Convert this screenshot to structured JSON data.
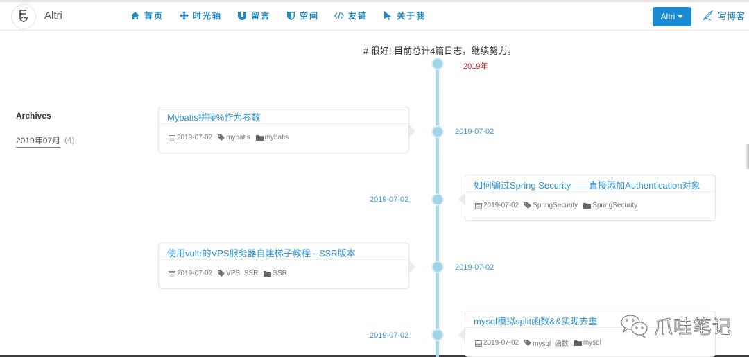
{
  "navbar": {
    "brand": "Altri",
    "logo_icon": "smiley-e-logo-icon",
    "items": [
      {
        "label": "首页",
        "icon": "home-icon"
      },
      {
        "label": "时光轴",
        "icon": "arrows-move-icon"
      },
      {
        "label": "留言",
        "icon": "magnet-icon"
      },
      {
        "label": "空间",
        "icon": "shield-icon"
      },
      {
        "label": "友链",
        "icon": "code-icon"
      },
      {
        "label": "关于我",
        "icon": "pointer-icon"
      }
    ],
    "user_button": "Altri",
    "write_label": "写博客"
  },
  "headline": "# 很好! 目前总计4篇日志，继续努力。",
  "sidebar": {
    "title": "Archives",
    "archives": [
      {
        "label": "2019年07月",
        "count": "(4)"
      }
    ]
  },
  "timeline": {
    "year": "2019年",
    "posts": [
      {
        "title": "Mybatis拼接%作为参数",
        "date": "2019-07-02",
        "tags": "mybatis",
        "category": "mybatis",
        "side": "left"
      },
      {
        "title": "如何骗过Spring Security——直接添加Authentication对象",
        "date": "2019-07-02",
        "tags": "SpringSecurity",
        "category": "SpringSecurity",
        "side": "right"
      },
      {
        "title": "使用vultr的VPS服务器自建梯子教程 --SSR版本",
        "date": "2019-07-02",
        "tags": "VPS  SSR",
        "category": "SSR",
        "side": "left"
      },
      {
        "title": "mysql模拟split函数&&实现去重",
        "date": "2019-07-02",
        "tags": "mysql  函数",
        "category": "mysql",
        "side": "right"
      }
    ]
  },
  "watermark": "爪哇笔记",
  "colors": {
    "accent": "#1e88c7",
    "button": "#1a8ad1",
    "year": "#d9262a",
    "timeline": "#a8d8ea"
  }
}
